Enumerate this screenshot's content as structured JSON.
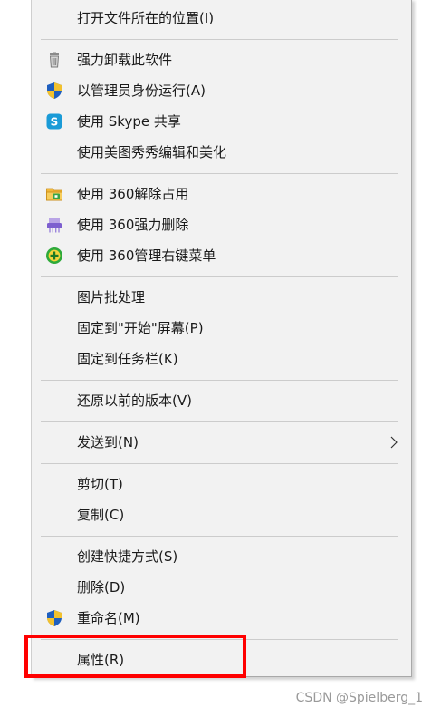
{
  "menu": {
    "items": [
      {
        "label": "打开文件所在的位置(I)",
        "icon": ""
      },
      {
        "label": "强力卸载此软件",
        "icon": "trash-icon"
      },
      {
        "label": "以管理员身份运行(A)",
        "icon": "uac-shield-icon"
      },
      {
        "label": "使用 Skype 共享",
        "icon": "skype-icon"
      },
      {
        "label": "使用美图秀秀编辑和美化",
        "icon": ""
      },
      {
        "label": "使用 360解除占用",
        "icon": "360-unlock-icon"
      },
      {
        "label": "使用 360强力删除",
        "icon": "360-shred-icon"
      },
      {
        "label": "使用 360管理右键菜单",
        "icon": "360-manage-icon"
      },
      {
        "label": "图片批处理",
        "icon": ""
      },
      {
        "label": "固定到\"开始\"屏幕(P)",
        "icon": ""
      },
      {
        "label": "固定到任务栏(K)",
        "icon": ""
      },
      {
        "label": "还原以前的版本(V)",
        "icon": ""
      },
      {
        "label": "发送到(N)",
        "icon": "",
        "submenu": true
      },
      {
        "label": "剪切(T)",
        "icon": ""
      },
      {
        "label": "复制(C)",
        "icon": ""
      },
      {
        "label": "创建快捷方式(S)",
        "icon": ""
      },
      {
        "label": "删除(D)",
        "icon": ""
      },
      {
        "label": "重命名(M)",
        "icon": "uac-shield-icon"
      },
      {
        "label": "属性(R)",
        "icon": "",
        "highlighted": true
      }
    ]
  },
  "highlight_color": "#ff0000",
  "watermark": "CSDN @Spielberg_1"
}
